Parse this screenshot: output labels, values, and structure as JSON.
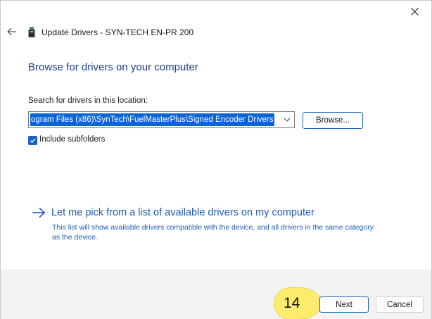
{
  "window": {
    "title": "Update Drivers - SYN-TECH EN-PR 200",
    "close_icon": "close-icon",
    "back_icon": "back-arrow-icon",
    "device_icon": "usb-device-icon"
  },
  "main": {
    "heading": "Browse for drivers on your computer",
    "search_label": "Search for drivers in this location:",
    "path_value": "ogram Files (x86)\\SynTech\\FuelMasterPlus\\Signed Encoder Drivers",
    "browse_label": "Browse...",
    "include_subfolders_label": "Include subfolders",
    "include_subfolders_checked": true,
    "pick_link": "Let me pick from a list of available drivers on my computer",
    "pick_description": "This list will show available drivers compatible with the device, and all drivers in the same category as the device."
  },
  "footer": {
    "step_number": "14",
    "next_label": "Next",
    "cancel_label": "Cancel"
  },
  "colors": {
    "accent": "#1d5ab8",
    "heading": "#1d3f8a",
    "selection": "#0a64d6",
    "badge": "#fdeb6e"
  }
}
